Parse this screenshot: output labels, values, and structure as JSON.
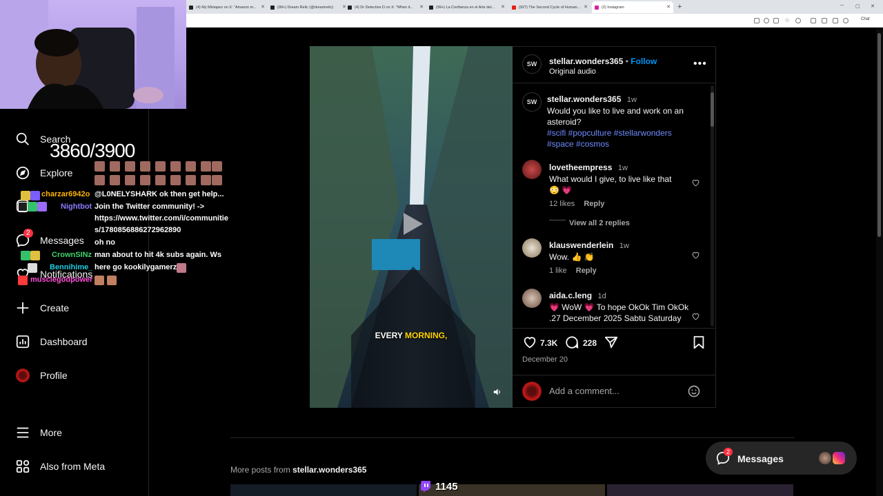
{
  "browser": {
    "tabs": [
      {
        "title": "(4) My Mixtapez on X: \"Amazon m...",
        "icon_color": "#111111"
      },
      {
        "title": "(99+) Dream Relic (@dreamrelic)",
        "icon_color": "#111111"
      },
      {
        "title": "(4) Dr Detective D on X: \"When it...",
        "icon_color": "#111111"
      },
      {
        "title": "(99+) La Confianza en el Arte del...",
        "icon_color": "#111111"
      },
      {
        "title": "(927) The Second Cycle of Human...",
        "icon_color": "#e62117"
      },
      {
        "title": "(2) Instagram",
        "icon_color": "#d6249f"
      }
    ],
    "new_tab": "+",
    "chat_label": "Chat"
  },
  "sidebar": {
    "items": [
      {
        "label": "Search",
        "icon": "search-icon"
      },
      {
        "label": "Explore",
        "icon": "compass-icon"
      },
      {
        "label": "Reels",
        "icon": "reels-icon"
      },
      {
        "label": "Messages",
        "icon": "messenger-icon",
        "badge": "2"
      },
      {
        "label": "Notifications",
        "icon": "heart-icon"
      },
      {
        "label": "Create",
        "icon": "plus-icon"
      },
      {
        "label": "Dashboard",
        "icon": "dashboard-icon"
      },
      {
        "label": "Profile",
        "icon": "avatar-icon"
      },
      {
        "label": "More",
        "icon": "menu-icon"
      },
      {
        "label": "Also from Meta",
        "icon": "meta-grid-icon"
      }
    ]
  },
  "post": {
    "username": "stellar.wonders365",
    "follow": "Follow",
    "separator": "•",
    "audio": "Original audio",
    "caption_overlay_a": "EVERY ",
    "caption_overlay_b": "MORNING,",
    "caption": {
      "username": "stellar.wonders365",
      "time": "1w",
      "text": "Would you like to live and work on an asteroid?",
      "hashtags_line1": "#scifi #popculture #stellarwonders",
      "hashtags_line2": "#space #cosmos"
    },
    "comments": [
      {
        "username": "lovetheempress",
        "time": "1w",
        "text": "What would I give, to live like that",
        "emoji": "😳 💗",
        "likes": "12 likes",
        "reply": "Reply",
        "view_replies": "View all 2 replies"
      },
      {
        "username": "klauswenderlein",
        "time": "1w",
        "text": "Wow. 👍 👏",
        "likes": "1 like",
        "reply": "Reply"
      },
      {
        "username": "aida.c.leng",
        "time": "1d",
        "text": "💗 WoW 💗 To hope OkOk Tim OkOk .27 December 2025 Sabtu Saturday"
      }
    ],
    "likes_count": "7.3K",
    "comments_count": "228",
    "date": "December 20",
    "add_comment_placeholder": "Add a comment..."
  },
  "more_posts": {
    "prefix": "More posts from ",
    "username": "stellar.wonders365"
  },
  "messages_pill": {
    "label": "Messages",
    "badge": "2"
  },
  "overlay": {
    "counter": "3860/3900",
    "chat": [
      {
        "name": "charzar6942o",
        "name_color": "#ffb400",
        "msg": "@L0NELYSHARK ok then get help..."
      },
      {
        "name": "Nightbot",
        "name_color": "#8b7bff",
        "msg": "Join the Twitter community! ->"
      },
      {
        "name": "",
        "name_color": "#ffffff",
        "msg": "https://www.twitter.com/i/communitie"
      },
      {
        "name": "",
        "name_color": "#ffffff",
        "msg": "s/1780856886272962890"
      },
      {
        "name": "",
        "name_color": "#ff4444",
        "msg": "oh no"
      },
      {
        "name": "CrownSINz",
        "name_color": "#3fd36b",
        "msg": "man about to hit 4k subs again. Ws"
      },
      {
        "name": "Bennihime_",
        "name_color": "#1ecbe1",
        "msg": "here go kookilygamerz"
      },
      {
        "name": "musclegodpower",
        "name_color": "#ff4fd8",
        "msg": ""
      }
    ],
    "twitch_count": "1145"
  }
}
